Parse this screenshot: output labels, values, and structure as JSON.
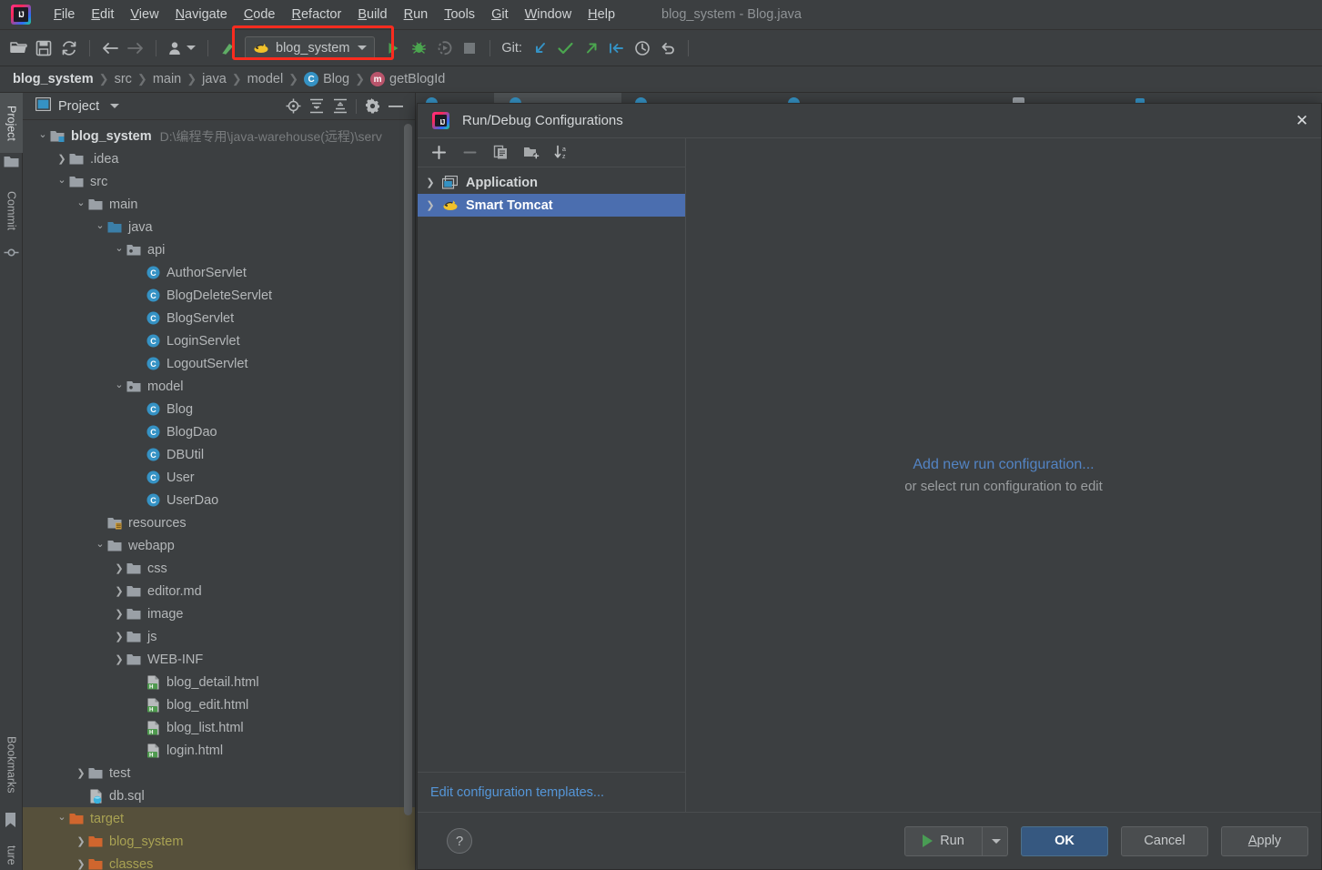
{
  "window": {
    "title": "blog_system - Blog.java"
  },
  "menubar": {
    "items": [
      {
        "label": "File",
        "mnemonic": "F"
      },
      {
        "label": "Edit",
        "mnemonic": "E"
      },
      {
        "label": "View",
        "mnemonic": "V"
      },
      {
        "label": "Navigate",
        "mnemonic": "N"
      },
      {
        "label": "Code",
        "mnemonic": "C"
      },
      {
        "label": "Refactor",
        "mnemonic": "R"
      },
      {
        "label": "Build",
        "mnemonic": "B"
      },
      {
        "label": "Run",
        "mnemonic": "R"
      },
      {
        "label": "Tools",
        "mnemonic": "T"
      },
      {
        "label": "Git",
        "mnemonic": "G"
      },
      {
        "label": "Window",
        "mnemonic": "W"
      },
      {
        "label": "Help",
        "mnemonic": "H"
      }
    ]
  },
  "toolbar": {
    "run_configuration": "blog_system",
    "git_label": "Git:",
    "highlight_color": "#fb2c1f",
    "icons": [
      "open-folder-icon",
      "save-all-icon",
      "sync-icon",
      "back-arrow-icon",
      "forward-arrow-icon",
      "user-dropdown-icon",
      "inspect-code-icon",
      "run-icon",
      "debug-icon",
      "run-with-coverage-icon",
      "stop-icon",
      "git-update-icon",
      "git-commit-icon",
      "git-push-icon",
      "git-rebase-icon",
      "git-history-icon",
      "git-rollback-icon"
    ]
  },
  "breadcrumb": {
    "items": [
      {
        "label": "blog_system",
        "icon": ""
      },
      {
        "label": "src",
        "icon": ""
      },
      {
        "label": "main",
        "icon": ""
      },
      {
        "label": "java",
        "icon": ""
      },
      {
        "label": "model",
        "icon": ""
      },
      {
        "label": "Blog",
        "icon": "class-badge",
        "badge": "C"
      },
      {
        "label": "getBlogId",
        "icon": "method-badge",
        "badge": "m"
      }
    ]
  },
  "toolstrip": {
    "items": [
      {
        "label": "Project",
        "active": true
      },
      {
        "label": "Commit",
        "active": false
      },
      {
        "label": "Bookmarks",
        "active": false
      },
      {
        "label": "ture",
        "active": false
      }
    ]
  },
  "project_panel": {
    "title": "Project",
    "header_icons": [
      "locate-icon",
      "expand-all-icon",
      "collapse-all-icon",
      "gear-icon",
      "hide-icon"
    ],
    "tree": [
      {
        "label": "blog_system",
        "path": "D:\\编程专用\\java-warehouse(远程)\\serv",
        "indent": 0,
        "arrow": "down",
        "icon": "module-folder-icon",
        "style": "bold"
      },
      {
        "label": ".idea",
        "indent": 1,
        "arrow": "right",
        "icon": "folder-icon",
        "style": "normal"
      },
      {
        "label": "src",
        "indent": 1,
        "arrow": "down",
        "icon": "folder-icon",
        "style": "normal"
      },
      {
        "label": "main",
        "indent": 2,
        "arrow": "down",
        "icon": "folder-icon",
        "style": "normal"
      },
      {
        "label": "java",
        "indent": 3,
        "arrow": "down",
        "icon": "source-folder-icon",
        "style": "normal"
      },
      {
        "label": "api",
        "indent": 4,
        "arrow": "down",
        "icon": "package-icon",
        "style": "normal"
      },
      {
        "label": "AuthorServlet",
        "indent": 5,
        "arrow": "none",
        "icon": "class-icon",
        "style": "normal"
      },
      {
        "label": "BlogDeleteServlet",
        "indent": 5,
        "arrow": "none",
        "icon": "class-icon",
        "style": "normal"
      },
      {
        "label": "BlogServlet",
        "indent": 5,
        "arrow": "none",
        "icon": "class-icon",
        "style": "normal"
      },
      {
        "label": "LoginServlet",
        "indent": 5,
        "arrow": "none",
        "icon": "class-icon",
        "style": "normal"
      },
      {
        "label": "LogoutServlet",
        "indent": 5,
        "arrow": "none",
        "icon": "class-icon",
        "style": "normal"
      },
      {
        "label": "model",
        "indent": 4,
        "arrow": "down",
        "icon": "package-icon",
        "style": "normal"
      },
      {
        "label": "Blog",
        "indent": 5,
        "arrow": "none",
        "icon": "class-icon",
        "style": "normal"
      },
      {
        "label": "BlogDao",
        "indent": 5,
        "arrow": "none",
        "icon": "class-icon",
        "style": "normal"
      },
      {
        "label": "DBUtil",
        "indent": 5,
        "arrow": "none",
        "icon": "class-icon",
        "style": "normal"
      },
      {
        "label": "User",
        "indent": 5,
        "arrow": "none",
        "icon": "class-icon",
        "style": "normal"
      },
      {
        "label": "UserDao",
        "indent": 5,
        "arrow": "none",
        "icon": "class-icon",
        "style": "normal"
      },
      {
        "label": "resources",
        "indent": 3,
        "arrow": "none",
        "icon": "resources-folder-icon",
        "style": "normal"
      },
      {
        "label": "webapp",
        "indent": 3,
        "arrow": "down",
        "icon": "folder-icon",
        "style": "normal"
      },
      {
        "label": "css",
        "indent": 4,
        "arrow": "right",
        "icon": "folder-icon",
        "style": "normal"
      },
      {
        "label": "editor.md",
        "indent": 4,
        "arrow": "right",
        "icon": "folder-icon",
        "style": "normal"
      },
      {
        "label": "image",
        "indent": 4,
        "arrow": "right",
        "icon": "folder-icon",
        "style": "normal"
      },
      {
        "label": "js",
        "indent": 4,
        "arrow": "right",
        "icon": "folder-icon",
        "style": "normal"
      },
      {
        "label": "WEB-INF",
        "indent": 4,
        "arrow": "right",
        "icon": "folder-icon",
        "style": "normal"
      },
      {
        "label": "blog_detail.html",
        "indent": 5,
        "arrow": "none",
        "icon": "html-file-icon",
        "style": "normal"
      },
      {
        "label": "blog_edit.html",
        "indent": 5,
        "arrow": "none",
        "icon": "html-file-icon",
        "style": "normal"
      },
      {
        "label": "blog_list.html",
        "indent": 5,
        "arrow": "none",
        "icon": "html-file-icon",
        "style": "normal"
      },
      {
        "label": "login.html",
        "indent": 5,
        "arrow": "none",
        "icon": "html-file-icon",
        "style": "normal"
      },
      {
        "label": "test",
        "indent": 2,
        "arrow": "right",
        "icon": "folder-icon",
        "style": "normal"
      },
      {
        "label": "db.sql",
        "indent": 2,
        "arrow": "none",
        "icon": "sql-file-icon",
        "style": "normal"
      },
      {
        "label": "target",
        "indent": 1,
        "arrow": "down",
        "icon": "excluded-folder-icon",
        "style": "yellow",
        "highlighted": true
      },
      {
        "label": "blog_system",
        "indent": 2,
        "arrow": "right",
        "icon": "excluded-folder-icon",
        "style": "yellow",
        "highlighted": true
      },
      {
        "label": "classes",
        "indent": 2,
        "arrow": "right",
        "icon": "excluded-folder-icon",
        "style": "yellow",
        "highlighted": true
      }
    ]
  },
  "dialog": {
    "title": "Run/Debug Configurations",
    "close_label": "✕",
    "toolbar_icons": [
      "add-icon",
      "remove-icon",
      "copy-icon",
      "new-folder-icon",
      "sort-alphabetically-icon"
    ],
    "configurations": [
      {
        "label": "Application",
        "icon": "application-icon",
        "selected": false,
        "arrow": "right"
      },
      {
        "label": "Smart Tomcat",
        "icon": "tomcat-icon",
        "selected": true,
        "arrow": "right"
      }
    ],
    "edit_templates_link": "Edit configuration templates...",
    "empty_state": {
      "link": "Add new run configuration...",
      "hint": "or select run configuration to edit"
    },
    "help_label": "?",
    "buttons": {
      "run": "Run",
      "ok": "OK",
      "cancel": "Cancel",
      "apply": "Apply",
      "apply_mnemonic": "A"
    },
    "selection_color": "#4b6eaf",
    "primary_button_color": "#365880"
  }
}
